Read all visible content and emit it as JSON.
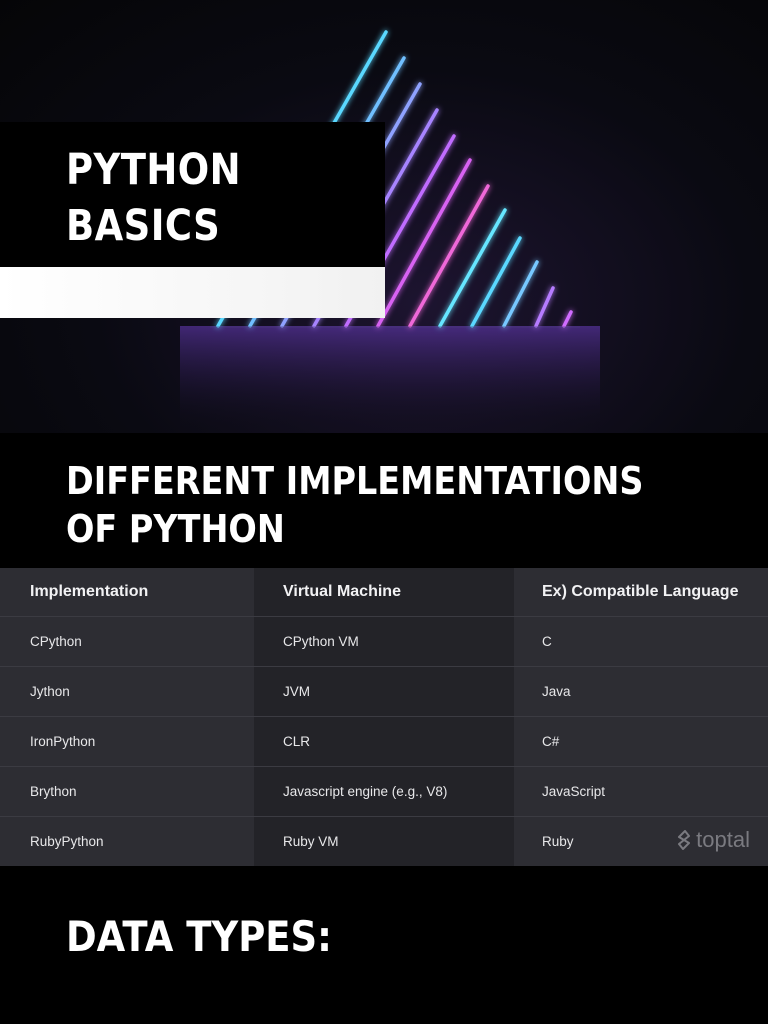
{
  "hero": {
    "title_lines": [
      "PYTHON",
      "BASICS"
    ]
  },
  "implementations": {
    "heading_lines": [
      "DIFFERENT IMPLEMENTATIONS",
      "OF PYTHON"
    ],
    "table": {
      "headers": [
        "Implementation",
        "Virtual Machine",
        "Ex) Compatible Language"
      ],
      "rows": [
        [
          "CPython",
          "CPython VM",
          "C"
        ],
        [
          "Jython",
          "JVM",
          "Java"
        ],
        [
          "IronPython",
          "CLR",
          "C#"
        ],
        [
          "Brython",
          "Javascript engine (e.g., V8)",
          "JavaScript"
        ],
        [
          "RubyPython",
          "Ruby VM",
          "Ruby"
        ]
      ]
    },
    "watermark": "toptal"
  },
  "data_types": {
    "heading": "DATA TYPES:"
  },
  "colors": {
    "background": "#000000",
    "table_light": "#2d2d33",
    "table_dark": "#232328",
    "neon_cyan": "#4fe3ff",
    "neon_magenta": "#d45cff"
  }
}
